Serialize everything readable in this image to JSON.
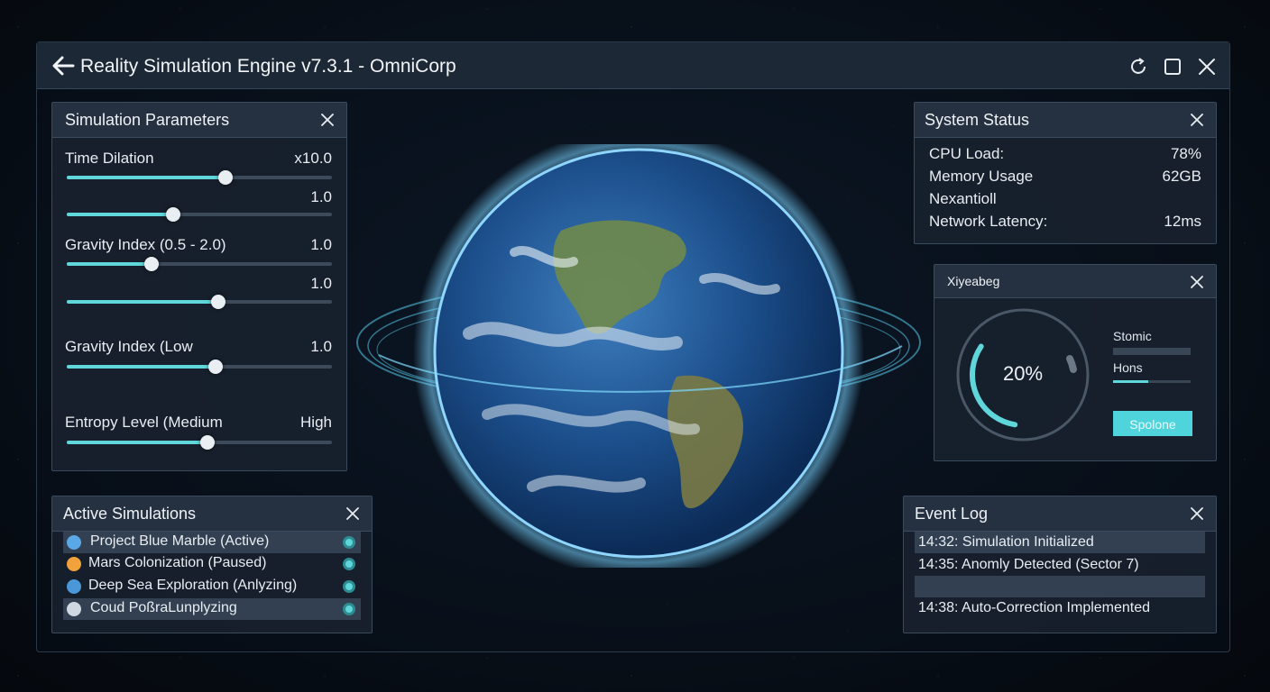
{
  "window": {
    "title": "Reality Simulation Engine v7.3.1 - OmniCorp"
  },
  "parameters": {
    "title": "Simulation Parameters",
    "items": [
      {
        "label": "Time Dilation",
        "value": "x10.0",
        "level": 0.6
      },
      {
        "label": "",
        "value": "1.0",
        "level": 0.4
      },
      {
        "label": "Gravity Index (0.5 - 2.0)",
        "value": "1.0",
        "level": 0.32
      },
      {
        "label": "",
        "value": "1.0",
        "level": 0.57
      },
      {
        "label": "Gravity Index (Low",
        "value": "1.0",
        "level": 0.56
      },
      {
        "label": "Entropy Level (Medium",
        "value": "High",
        "level": 0.53
      }
    ]
  },
  "simulations": {
    "title": "Active Simulations",
    "items": [
      {
        "label": "Project Blue Marble (Active)",
        "icon": "earth-icon",
        "color": "#5aa9e6"
      },
      {
        "label": "Mars Colonization (Paused)",
        "icon": "mars-icon",
        "color": "#f2a23a"
      },
      {
        "label": "Deep Sea Exploration (Anlyzing)",
        "icon": "ocean-icon",
        "color": "#4a98d8"
      },
      {
        "label": "Coud PoßraLunplyzing",
        "icon": "cloud-icon",
        "color": "#cfd8e0"
      }
    ]
  },
  "system": {
    "title": "System Status",
    "rows": [
      {
        "label": "CPU Load:",
        "value": "78%"
      },
      {
        "label": "Memory Usage",
        "value": "62GB"
      },
      {
        "label": "Nexantioll",
        "value": ""
      },
      {
        "label": "Network Latency:",
        "value": "12ms"
      }
    ]
  },
  "widget": {
    "title": "Xiyeabeg",
    "gauge_label": "20%",
    "gauge_level": 0.2,
    "stat1_label": "Stomic",
    "stat1_level": 0.0,
    "stat2_label": "Hons",
    "stat2_level": 0.45,
    "button_label": "Spolone"
  },
  "log": {
    "title": "Event Log",
    "entries": [
      "14:32: Simulation Initialized",
      "14:35: Anomly Detected (Sector 7)",
      "",
      "14:38: Auto-Correction Implemented"
    ]
  },
  "colors": {
    "accent": "#5fd6da",
    "panel": "#18222f",
    "text": "#e8edf2"
  }
}
